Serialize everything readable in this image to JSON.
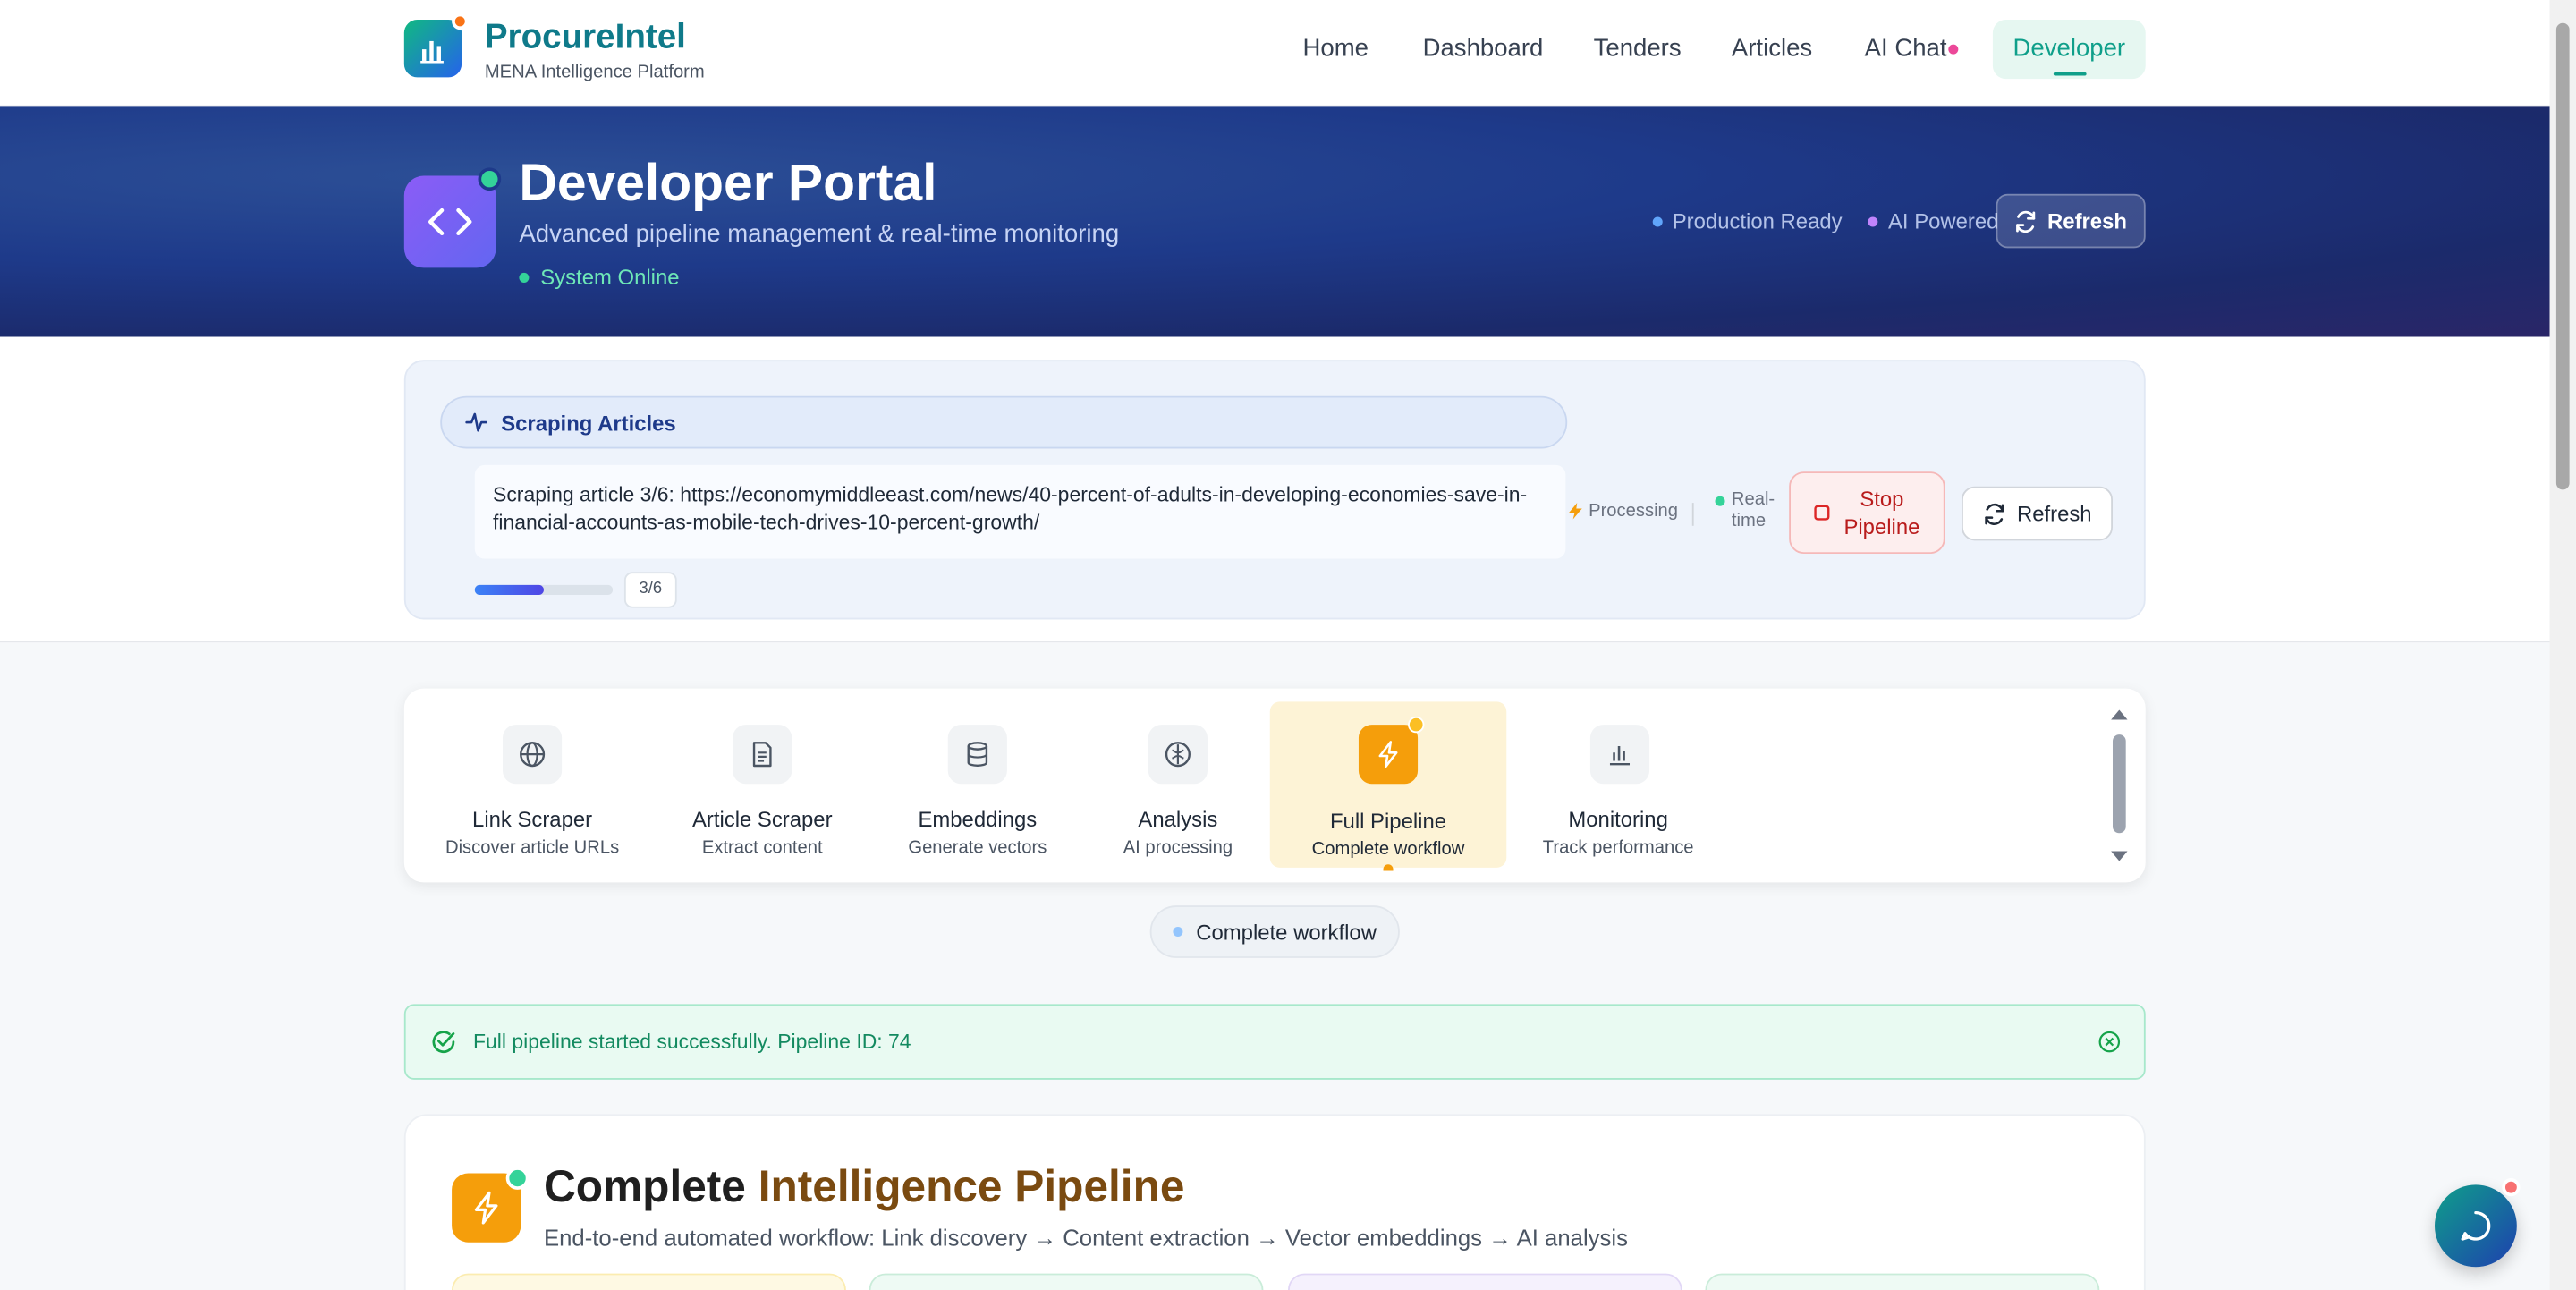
{
  "header": {
    "brand_name": "ProcureIntel",
    "brand_sub": "MENA Intelligence Platform",
    "nav": [
      {
        "label": "Home"
      },
      {
        "label": "Dashboard"
      },
      {
        "label": "Tenders"
      },
      {
        "label": "Articles"
      },
      {
        "label": "AI Chat"
      },
      {
        "label": "Developer",
        "active": true
      }
    ]
  },
  "hero": {
    "title": "Developer Portal",
    "subtitle": "Advanced pipeline management & real-time monitoring",
    "status": "System Online",
    "badges": [
      "Production Ready",
      "AI Powered"
    ],
    "refresh_label": "Refresh"
  },
  "scrape_status": {
    "heading": "Scraping Articles",
    "message": "Scraping article 3/6: https://economymiddleeast.com/news/40-percent-of-adults-in-developing-economies-save-in-financial-accounts-as-mobile-tech-drives-10-percent-growth/",
    "progress_fraction": 0.5,
    "progress_count": "3/6",
    "processing_label": "Processing",
    "realtime_label_1": "Real-",
    "realtime_label_2": "time",
    "stop_label_1": "Stop",
    "stop_label_2": "Pipeline",
    "refresh_label": "Refresh"
  },
  "tabs": [
    {
      "label": "Link Scraper",
      "desc": "Discover article URLs",
      "icon": "globe-icon"
    },
    {
      "label": "Article Scraper",
      "desc": "Extract content",
      "icon": "document-icon"
    },
    {
      "label": "Embeddings",
      "desc": "Generate vectors",
      "icon": "database-icon"
    },
    {
      "label": "Analysis",
      "desc": "AI processing",
      "icon": "brain-icon"
    },
    {
      "label": "Full Pipeline",
      "desc": "Complete workflow",
      "icon": "lightning-icon",
      "active": true
    },
    {
      "label": "Monitoring",
      "desc": "Track performance",
      "icon": "bar-chart-icon"
    }
  ],
  "workflow_pill": "Complete workflow",
  "alert": {
    "message": "Full pipeline started successfully. Pipeline ID: 74"
  },
  "section": {
    "title_part1": "Complete ",
    "title_part2": "Intelligence Pipeline",
    "subtitle": "End-to-end automated workflow: Link discovery → Content extraction → Vector embeddings → AI analysis"
  },
  "colors": {
    "brand_teal": "#0f9f8a",
    "hero_navy": "#1e3a8a",
    "accent_amber": "#f59e0b",
    "success_green": "#138a60",
    "danger_red": "#b91c1c"
  }
}
